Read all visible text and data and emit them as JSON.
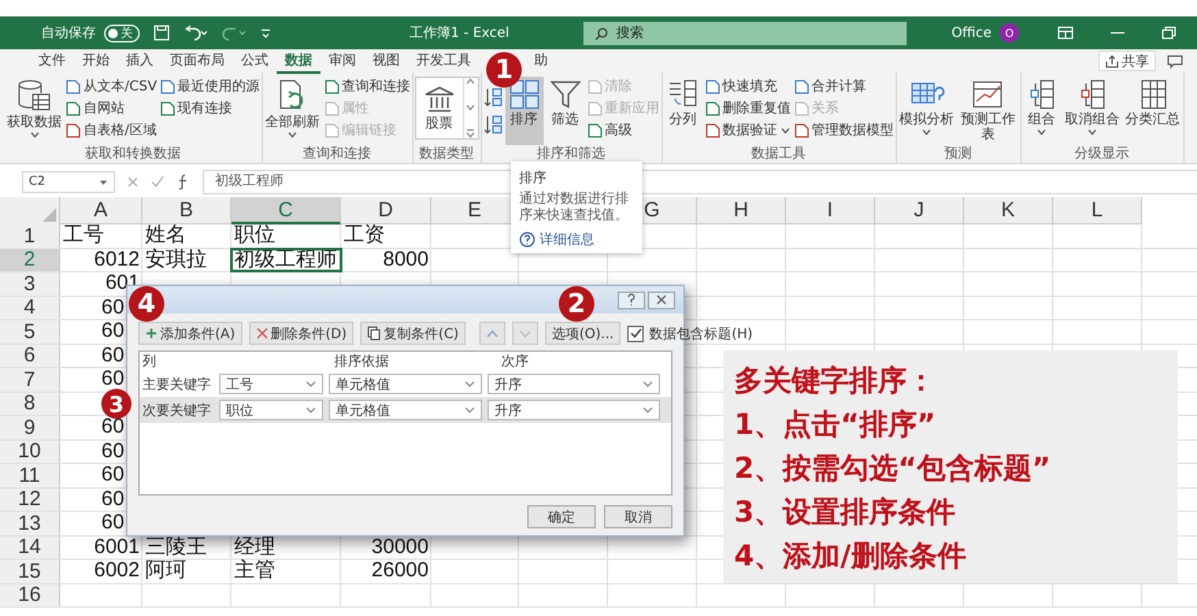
{
  "title_bar": {
    "autosave": "自动保存",
    "autosave_toggle": {
      "label": "关",
      "on": false
    },
    "title": "工作簿1 - Excel",
    "search": {
      "placeholder": "搜索"
    },
    "user": "Office",
    "avatar": "O"
  },
  "menu_tabs": [
    {
      "label": "文件",
      "selected": false
    },
    {
      "label": "开始",
      "selected": false
    },
    {
      "label": "插入",
      "selected": false
    },
    {
      "label": "页面布局",
      "selected": false
    },
    {
      "label": "公式",
      "selected": false
    },
    {
      "label": "数据",
      "selected": true
    },
    {
      "label": "审阅",
      "selected": false
    },
    {
      "label": "视图",
      "selected": false
    },
    {
      "label": "开发工具",
      "selected": false
    },
    {
      "label": "助",
      "selected": false
    }
  ],
  "share": "共享",
  "ribbon_groups": [
    {
      "label": "获取和转换数据",
      "items": [
        {
          "kind": "large",
          "label": "获取数据",
          "dropdown": true,
          "selected": false,
          "disabled": false
        },
        {
          "kind": "small",
          "label": "从文本/CSV",
          "disabled": false
        },
        {
          "kind": "small",
          "label": "自网站",
          "disabled": false
        },
        {
          "kind": "small",
          "label": "自表格/区域",
          "disabled": false
        },
        {
          "kind": "small",
          "label": "最近使用的源",
          "disabled": false
        },
        {
          "kind": "small",
          "label": "现有连接",
          "disabled": false
        }
      ]
    },
    {
      "label": "查询和连接",
      "items": [
        {
          "kind": "large",
          "label": "全部刷新",
          "dropdown": true,
          "selected": false,
          "disabled": false
        },
        {
          "kind": "small",
          "label": "查询和连接",
          "disabled": false
        },
        {
          "kind": "small",
          "label": "属性",
          "disabled": true
        },
        {
          "kind": "small",
          "label": "编辑链接",
          "disabled": true
        }
      ]
    },
    {
      "label": "数据类型",
      "items": [
        {
          "kind": "gallery",
          "label": "股票"
        }
      ]
    },
    {
      "label": "排序和筛选",
      "items": [
        {
          "kind": "sortpair"
        },
        {
          "kind": "large",
          "label": "排序",
          "dropdown": false,
          "selected": true,
          "disabled": false
        },
        {
          "kind": "large",
          "label": "筛选",
          "dropdown": false,
          "selected": false,
          "disabled": false
        },
        {
          "kind": "small",
          "label": "清除",
          "disabled": true
        },
        {
          "kind": "small",
          "label": "重新应用",
          "disabled": true
        },
        {
          "kind": "small",
          "label": "高级",
          "disabled": false
        }
      ]
    },
    {
      "label": "数据工具",
      "items": [
        {
          "kind": "large",
          "label": "分列",
          "dropdown": false,
          "selected": false,
          "disabled": false
        },
        {
          "kind": "small",
          "label": "快速填充",
          "disabled": false
        },
        {
          "kind": "small",
          "label": "删除重复值",
          "disabled": false
        },
        {
          "kind": "small",
          "label": "数据验证",
          "dropdown": true,
          "disabled": false
        },
        {
          "kind": "small",
          "label": "合并计算",
          "disabled": false
        },
        {
          "kind": "small",
          "label": "关系",
          "disabled": true
        },
        {
          "kind": "small",
          "label": "管理数据模型",
          "disabled": false
        }
      ]
    },
    {
      "label": "预测",
      "items": [
        {
          "kind": "large",
          "label": "模拟分析",
          "dropdown": true,
          "selected": false,
          "disabled": false
        },
        {
          "kind": "large",
          "label": "预测工作表",
          "dropdown": false,
          "selected": false,
          "disabled": false
        }
      ]
    },
    {
      "label": "分级显示",
      "items": [
        {
          "kind": "large",
          "label": "组合",
          "dropdown": true,
          "selected": false,
          "disabled": false
        },
        {
          "kind": "large",
          "label": "取消组合",
          "dropdown": true,
          "selected": false,
          "disabled": false
        },
        {
          "kind": "large",
          "label": "分类汇总",
          "dropdown": false,
          "selected": false,
          "disabled": false
        }
      ]
    }
  ],
  "tooltip": {
    "title": "排序",
    "text": "通过对数据进行排序来快速查找值。",
    "link": "详细信息"
  },
  "formula_bar": {
    "name_box": "C2",
    "value": "初级工程师"
  },
  "sheet": {
    "columns": [
      {
        "label": "A",
        "selected": false
      },
      {
        "label": "B",
        "selected": false
      },
      {
        "label": "C",
        "selected": true
      },
      {
        "label": "D",
        "selected": false
      },
      {
        "label": "E",
        "selected": false
      },
      {},
      {
        "label": "G",
        "selected": false
      },
      {
        "label": "H",
        "selected": false
      },
      {
        "label": "I",
        "selected": false
      },
      {
        "label": "J",
        "selected": false
      },
      {
        "label": "K",
        "selected": false
      },
      {
        "label": "L",
        "selected": false
      }
    ],
    "rows": [
      {
        "label": "1",
        "kind": "header",
        "selected": false,
        "cells": [
          "工号",
          "姓名",
          "职位",
          "工资"
        ]
      },
      {
        "label": "2",
        "kind": "data",
        "selected": true,
        "cells": [
          "6012",
          "安琪拉",
          "初级工程师",
          "8000"
        ]
      },
      {
        "label": "3",
        "kind": "data",
        "selected": false,
        "cells": [
          "601"
        ]
      },
      {
        "label": "4",
        "kind": "cut",
        "selected": false,
        "cells": [
          "60"
        ]
      },
      {
        "label": "5",
        "kind": "cut",
        "selected": false,
        "cells": [
          "60"
        ]
      },
      {
        "label": "6",
        "kind": "cut",
        "selected": false,
        "cells": [
          "60"
        ]
      },
      {
        "label": "7",
        "kind": "cut",
        "selected": false,
        "cells": [
          "60"
        ]
      },
      {
        "label": "8",
        "selected": false,
        "cells": []
      },
      {
        "label": "9",
        "kind": "cut",
        "selected": false,
        "cells": [
          "60"
        ]
      },
      {
        "label": "10",
        "kind": "cut",
        "selected": false,
        "cells": [
          "60"
        ]
      },
      {
        "label": "11",
        "kind": "cut",
        "selected": false,
        "cells": [
          "60"
        ]
      },
      {
        "label": "12",
        "kind": "cut",
        "selected": false,
        "cells": [
          "60"
        ]
      },
      {
        "label": "13",
        "kind": "cut",
        "selected": false,
        "cells": [
          "60"
        ]
      },
      {
        "label": "14",
        "kind": "data",
        "selected": false,
        "cells": [
          "6001",
          "三陵王",
          "经理",
          "30000"
        ]
      },
      {
        "label": "15",
        "kind": "data",
        "selected": false,
        "cells": [
          "6002",
          "阿珂",
          "主管",
          "26000"
        ]
      },
      {
        "label": "16",
        "selected": false,
        "cells": []
      }
    ]
  },
  "sort_dialog": {
    "toolbar": [
      {
        "kind": "add",
        "label": "添加条件(A)"
      },
      {
        "kind": "delete",
        "label": "删除条件(D)"
      },
      {
        "kind": "copy",
        "label": "复制条件(C)"
      },
      {
        "kind": "up"
      },
      {
        "kind": "down"
      },
      {
        "kind": "text",
        "label": "选项(O)..."
      }
    ],
    "has_headers": {
      "label": "数据包含标题(H)",
      "checked": true
    },
    "columns": [
      "列",
      "排序依据",
      "次序"
    ],
    "levels": [
      {
        "label": "主要关键字",
        "column": "工号",
        "basis": "单元格值",
        "order": "升序",
        "selected": false
      },
      {
        "label": "次要关键字",
        "column": "职位",
        "basis": "单元格值",
        "order": "升序",
        "selected": true
      }
    ],
    "buttons": [
      "确定",
      "取消"
    ]
  },
  "step_markers": [
    "1",
    "2",
    "3",
    "4"
  ],
  "notes": {
    "title": "多关键字排序：",
    "steps": [
      "1、点击“排序”",
      "2、按需勾选“包含标题”",
      "3、设置排序条件",
      "4、添加/删除条件"
    ]
  }
}
